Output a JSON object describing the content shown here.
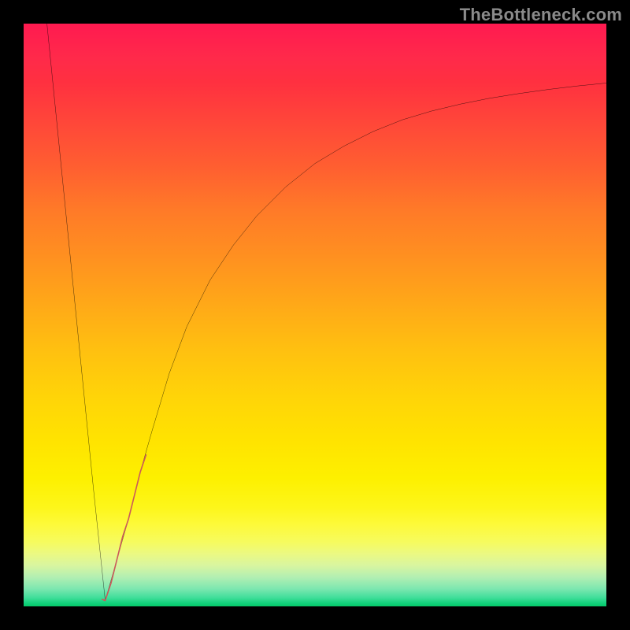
{
  "watermark": "TheBottleneck.com",
  "colors": {
    "background_frame": "#000000",
    "curve_stroke": "#000000",
    "highlight_stroke": "#cb5a5a",
    "watermark_text": "#8a8a8a"
  },
  "chart_data": {
    "type": "line",
    "title": "",
    "xlabel": "",
    "ylabel": "",
    "xlim": [
      0,
      100
    ],
    "ylim": [
      0,
      100
    ],
    "grid": false,
    "legend": false,
    "note": "Values estimated from pixels. x and y are normalized 0–100 (left→right, bottom→top).",
    "series": [
      {
        "name": "left-descent",
        "x": [
          4,
          6,
          8,
          10,
          12,
          14
        ],
        "y": [
          100,
          80,
          60,
          40,
          20,
          1
        ]
      },
      {
        "name": "right-curve",
        "x": [
          14,
          16,
          18,
          20,
          22,
          25,
          28,
          32,
          36,
          40,
          45,
          50,
          55,
          60,
          65,
          70,
          75,
          80,
          85,
          90,
          95,
          100
        ],
        "y": [
          1,
          8,
          15,
          23,
          30,
          40,
          48,
          56,
          62,
          67,
          72,
          76,
          79,
          81.5,
          83.5,
          85,
          86.2,
          87.2,
          88,
          88.7,
          89.3,
          89.8
        ]
      },
      {
        "name": "highlight-segment",
        "x": [
          13.5,
          14,
          15,
          16,
          17,
          18,
          19,
          20,
          21
        ],
        "y": [
          1.2,
          1,
          4,
          8,
          12,
          15,
          19,
          23,
          26
        ]
      }
    ]
  }
}
